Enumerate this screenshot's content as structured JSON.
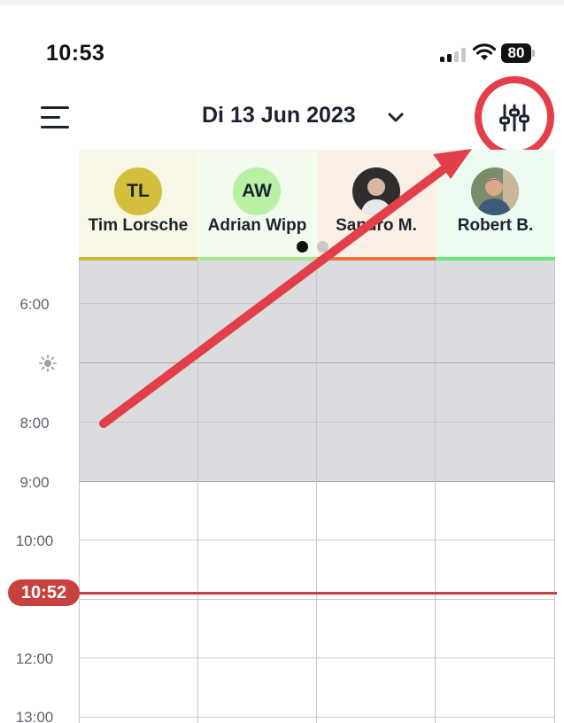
{
  "status_bar": {
    "time": "10:53",
    "battery": "80"
  },
  "header": {
    "date": "Di 13 Jun 2023"
  },
  "staff": [
    {
      "initials": "TL",
      "name": "Tim Lorsche",
      "avatar_color": "#d4bf3c",
      "column_bg": "#f8f6e4",
      "bar_color": "#cdb63a"
    },
    {
      "initials": "AW",
      "name": "Adrian Wipp",
      "avatar_color": "#b8f0a4",
      "column_bg": "#f2fbee",
      "bar_color": "#a9e88f"
    },
    {
      "initials": "",
      "name": "Sandro M.",
      "avatar_color": "#3a3a3a",
      "column_bg": "#fcefe5",
      "bar_color": "#e8763a"
    },
    {
      "initials": "",
      "name": "Robert B.",
      "avatar_color": "#4a6a88",
      "column_bg": "#edfaf0",
      "bar_color": "#6be87a"
    }
  ],
  "pager": {
    "active_color": "#111111",
    "inactive_color": "#c8c8c8"
  },
  "time_labels": [
    "6:00",
    "8:00",
    "9:00",
    "10:00",
    "12:00",
    "13:00"
  ],
  "current_time": "10:52",
  "annotation_color": "#e33f4a"
}
